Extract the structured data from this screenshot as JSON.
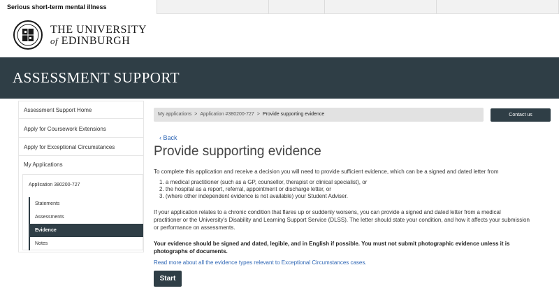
{
  "tabs": [
    {
      "label": "Serious short-term mental illness"
    },
    {
      "label": ""
    },
    {
      "label": ""
    },
    {
      "label": ""
    },
    {
      "label": ""
    }
  ],
  "university": {
    "line1": "THE UNIVERSITY",
    "line2_of": "of",
    "line2_name": "EDINBURGH"
  },
  "banner": {
    "title": "ASSESSMENT SUPPORT"
  },
  "sidebar": {
    "items": [
      {
        "label": "Assessment Support Home"
      },
      {
        "label": "Apply for Coursework Extensions"
      },
      {
        "label": "Apply for Exceptional Circumstances"
      },
      {
        "label": "My Applications"
      }
    ],
    "application": "Application 380200-727",
    "sub_items": [
      {
        "label": "Statements"
      },
      {
        "label": "Assessments"
      },
      {
        "label": "Evidence"
      },
      {
        "label": "Notes"
      }
    ]
  },
  "breadcrumb": {
    "part1": "My applications",
    "sep": ">",
    "part2": "Application #380200-727",
    "part3": "Provide supporting evidence"
  },
  "contact_button": "Contact us",
  "content": {
    "back": "Back",
    "title": "Provide supporting evidence",
    "intro": "To complete this application and receive a decision you will need to provide sufficient evidence, which can be a signed and dated letter from",
    "list": [
      "1. a medical practitioner (such as a GP, counsellor, therapist or clinical specialist), or",
      "2. the hospital as a report, referral, appointment or discharge letter, or",
      "3. (where other independent evidence is not available) your Student Adviser."
    ],
    "chronic_line1": "If your application relates to a chronic condition that flares up or suddenly worsens, you can provide a signed and dated letter from a medical",
    "chronic_line2": "practitioner or the University's Disability and Learning Support Service (DLSS). The letter should state your condition, and how it affects your submission",
    "chronic_line3": "or performance on assessments.",
    "warning_line1": "Your evidence should be signed and dated, legible, and in English if possible. You must not submit photographic evidence unless it is",
    "warning_line2": "photographs of documents.",
    "readmore": "Read more about all the evidence types relevant to Exceptional Circumstances cases.",
    "start": "Start"
  },
  "colors": {
    "banner": "#2f3e46",
    "link": "#2e66b5",
    "button": "#2f3e46"
  }
}
